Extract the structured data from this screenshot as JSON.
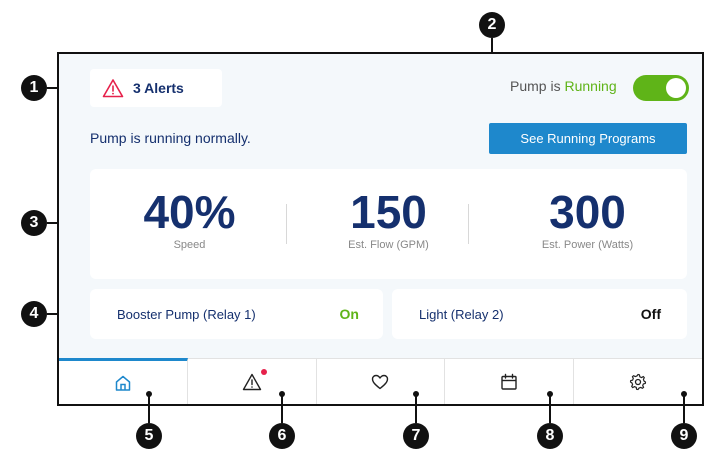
{
  "alerts": {
    "label": "3 Alerts",
    "icon": "warning-triangle-icon",
    "color": "#e6214b"
  },
  "pump": {
    "status_prefix": "Pump is ",
    "status_value": "Running",
    "toggle_on": true
  },
  "status_message": "Pump is running normally.",
  "see_programs_button": "See Running Programs",
  "stats": [
    {
      "value": "40%",
      "label": "Speed"
    },
    {
      "value": "150",
      "label": "Est. Flow (GPM)"
    },
    {
      "value": "300",
      "label": "Est. Power (Watts)"
    }
  ],
  "relays": [
    {
      "name": "Booster Pump (Relay 1)",
      "state": "On"
    },
    {
      "name": "Light (Relay 2)",
      "state": "Off"
    }
  ],
  "nav": [
    {
      "icon": "home-icon",
      "active": true
    },
    {
      "icon": "alert-icon",
      "badge": true
    },
    {
      "icon": "heart-icon"
    },
    {
      "icon": "calendar-icon"
    },
    {
      "icon": "gear-icon"
    }
  ],
  "callouts": [
    "1",
    "2",
    "3",
    "4",
    "5",
    "6",
    "7",
    "8",
    "9"
  ],
  "colors": {
    "navy": "#15306e",
    "green": "#5fb418",
    "blue": "#1e88cc",
    "red": "#e6214b"
  }
}
